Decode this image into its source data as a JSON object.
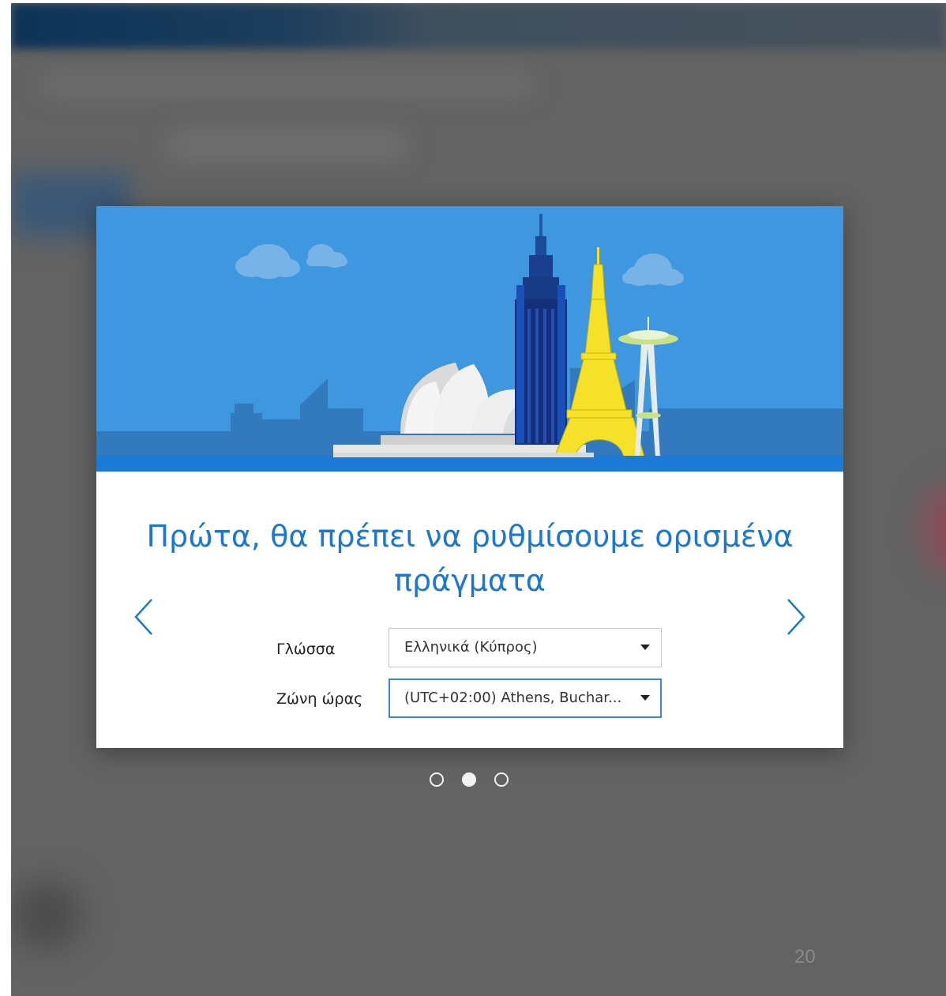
{
  "dialog": {
    "title": "Πρώτα, θα πρέπει να ρυθμίσουμε ορισμένα πράγματα",
    "nav": {
      "prev_icon": "chevron-left-icon",
      "next_icon": "chevron-right-icon"
    },
    "fields": {
      "language": {
        "label": "Γλώσσα",
        "value": "Ελληνικά (Κύπρος)"
      },
      "timezone": {
        "label": "Ζώνη ώρας",
        "value": "(UTC+02:00) Athens, Buchar..."
      }
    },
    "pagination": {
      "total": 3,
      "current": 2
    }
  },
  "page_number": "20",
  "colors": {
    "accent": "#1b78cf",
    "hero_sky": "#3f97e0",
    "focus_border": "#3d88d6",
    "backdrop": "#636363"
  }
}
